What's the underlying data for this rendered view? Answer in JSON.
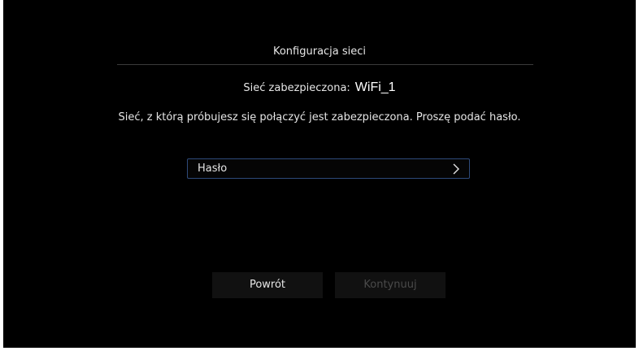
{
  "dialog": {
    "title": "Konfiguracja sieci",
    "network_label": "Sieć zabezpieczona:",
    "network_name": "WiFi_1",
    "message": "Sieć, z którą próbujesz się połączyć jest zabezpieczona. Proszę podać hasło.",
    "password_field": {
      "label": "Hasło",
      "icon": "chevron-right-icon"
    },
    "buttons": {
      "back_label": "Powrót",
      "continue_label": "Kontynuuj"
    }
  },
  "colors": {
    "background": "#000000",
    "text": "#e6e6e6",
    "field_border": "#2e4a7a",
    "button_bg": "#111111",
    "disabled_text": "#4a4a4a"
  }
}
